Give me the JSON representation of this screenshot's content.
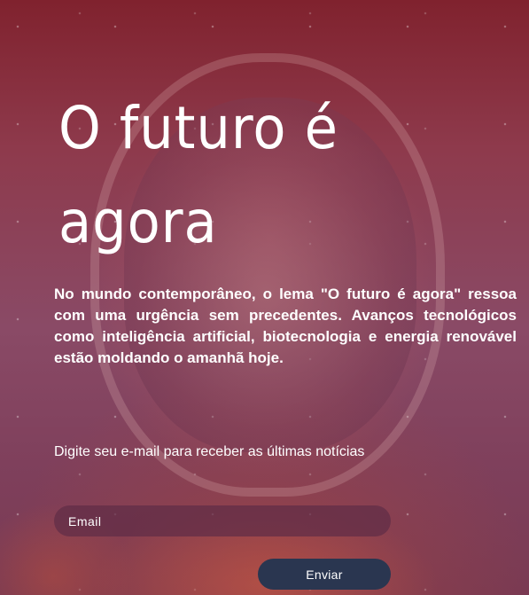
{
  "hero": {
    "title": "O futuro é agora",
    "lead": "No mundo contemporâneo, o lema \"O futuro é agora\" ressoa com uma urgência sem precedentes. Avanços tecnológicos como inteligência artificial, biotecnologia e energia renovável estão moldando o amanhã hoje."
  },
  "newsletter": {
    "prompt": "Digite seu e-mail para receber as últimas notícias",
    "email_placeholder": "Email",
    "email_value": "",
    "submit_label": "Enviar"
  },
  "colors": {
    "button_bg": "#2a3650",
    "input_bg": "#5f2d46",
    "text": "#ffffff"
  }
}
